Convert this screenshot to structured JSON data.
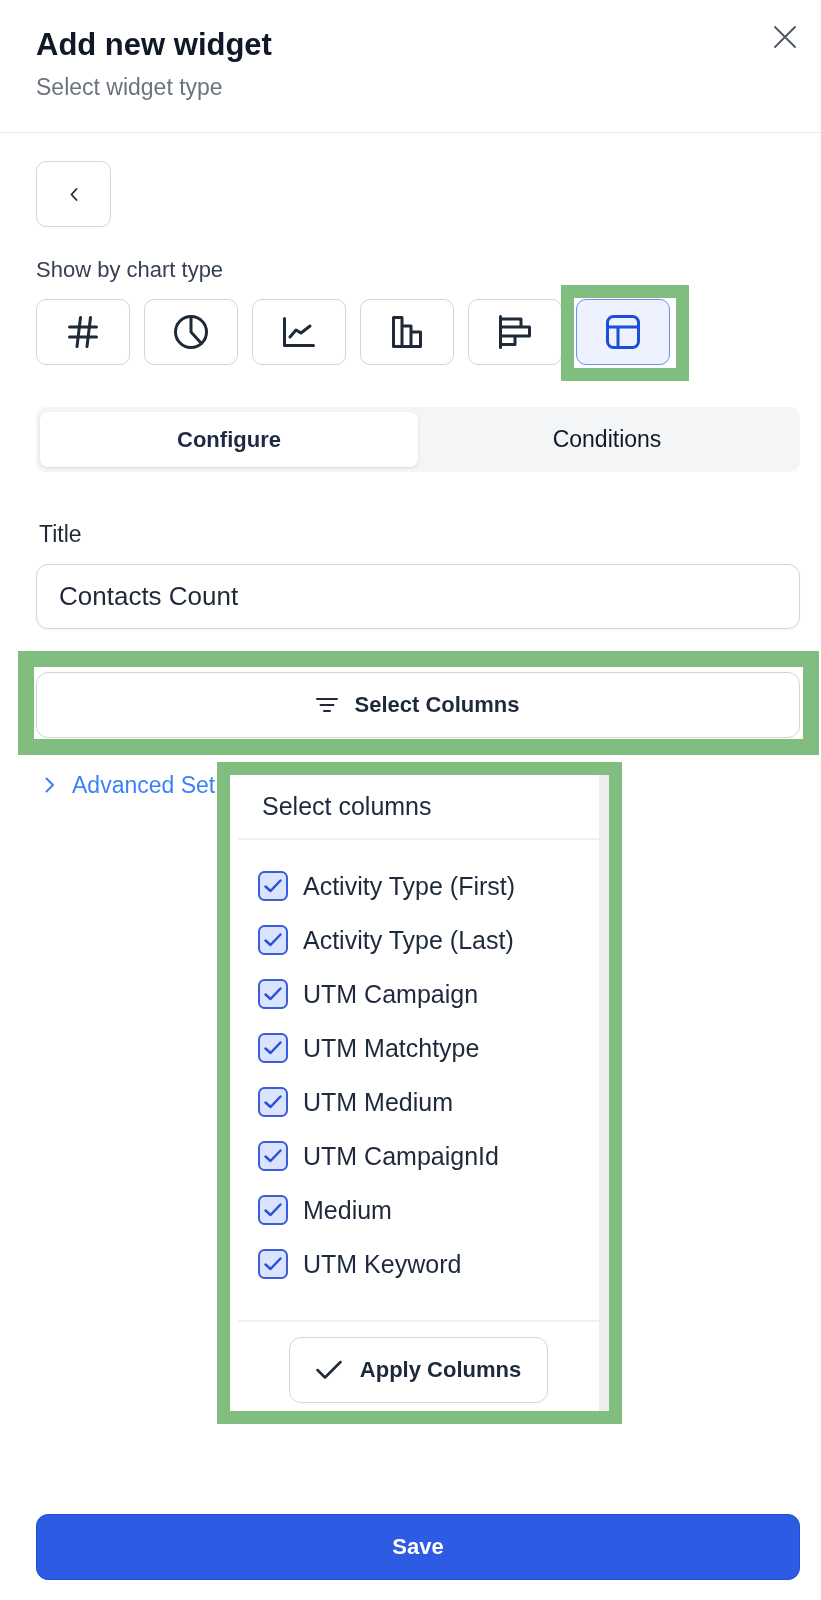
{
  "dialog": {
    "title": "Add new widget",
    "subtitle": "Select widget type"
  },
  "chart_type": {
    "label": "Show by chart type",
    "options": [
      {
        "kind": "number",
        "selected": false,
        "highlighted": false
      },
      {
        "kind": "pie",
        "selected": false,
        "highlighted": false
      },
      {
        "kind": "line",
        "selected": false,
        "highlighted": false
      },
      {
        "kind": "bar",
        "selected": false,
        "highlighted": false
      },
      {
        "kind": "hbar",
        "selected": false,
        "highlighted": false
      },
      {
        "kind": "table",
        "selected": true,
        "highlighted": true
      }
    ]
  },
  "tabs": [
    {
      "label": "Configure",
      "selected": true
    },
    {
      "label": "Conditions",
      "selected": false
    }
  ],
  "title_field": {
    "label": "Title",
    "value": "Contacts Count"
  },
  "select_columns_button": {
    "label": "Select Columns",
    "highlighted": true
  },
  "advanced_settings": {
    "label": "Advanced Set"
  },
  "column_picker": {
    "title": "Select columns",
    "highlighted": true,
    "items": [
      {
        "label": "Activity Type (First)",
        "checked": true
      },
      {
        "label": "Activity Type (Last)",
        "checked": true
      },
      {
        "label": "UTM Campaign",
        "checked": true
      },
      {
        "label": "UTM Matchtype",
        "checked": true
      },
      {
        "label": "UTM Medium",
        "checked": true
      },
      {
        "label": "UTM CampaignId",
        "checked": true
      },
      {
        "label": "Medium",
        "checked": true
      },
      {
        "label": "UTM Keyword",
        "checked": true
      }
    ],
    "apply_button": {
      "label": "Apply Columns"
    }
  },
  "save_button": {
    "label": "Save"
  }
}
